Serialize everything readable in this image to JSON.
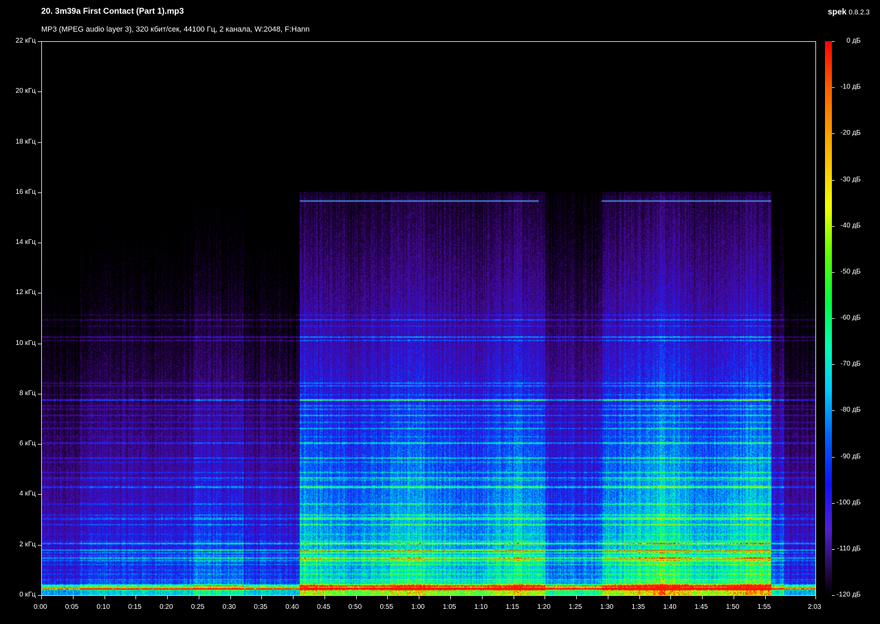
{
  "window": {
    "title": "20. 3m39a First Contact (Part 1).mp3",
    "description": "MP3 (MPEG audio layer 3), 320 кбит/сек, 44100 Гц, 2 канала, W:2048, F:Hann",
    "brand_name": "spek",
    "brand_version": "0.8.2.3"
  },
  "frequency_axis": {
    "labels": [
      "22 кГц",
      "20 кГц",
      "18 кГц",
      "16 кГц",
      "14 кГц",
      "12 кГц",
      "10 кГц",
      "8 кГц",
      "6 кГц",
      "4 кГц",
      "2 кГц",
      "0 кГц"
    ]
  },
  "time_axis": {
    "labels": [
      "0:00",
      "0:05",
      "0:10",
      "0:15",
      "0:20",
      "0:25",
      "0:30",
      "0:35",
      "0:40",
      "0:45",
      "0:50",
      "0:55",
      "1:00",
      "1:05",
      "1:10",
      "1:15",
      "1:20",
      "1:25",
      "1:30",
      "1:35",
      "1:40",
      "1:45",
      "1:50",
      "1:55",
      "2:03"
    ]
  },
  "db_scale": {
    "labels": [
      "0 дБ",
      "-10 дБ",
      "-20 дБ",
      "-30 дБ",
      "-40 дБ",
      "-50 дБ",
      "-60 дБ",
      "-70 дБ",
      "-80 дБ",
      "-90 дБ",
      "-100 дБ",
      "-110 дБ",
      "-120 дБ"
    ]
  },
  "colors": {
    "background": "#000000",
    "axis": "#d8d8d8",
    "text": "#ffffff"
  }
}
